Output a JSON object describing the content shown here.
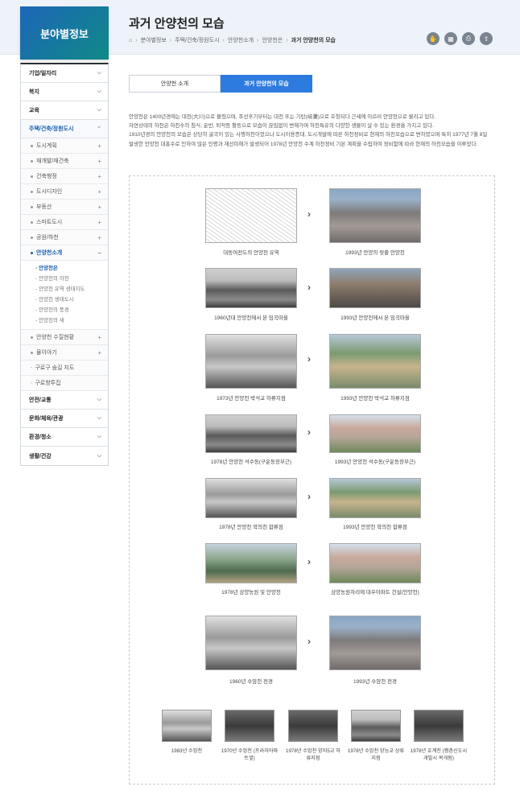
{
  "section_title": "분야별정보",
  "page": {
    "title": "과거 안양천의 모습",
    "breadcrumb": [
      "분야별정보",
      "주택/건축/정원도시",
      "안양천소개",
      "안양천은",
      "과거 안양천의 모습"
    ]
  },
  "tools": [
    {
      "icon": "hand-icon"
    },
    {
      "icon": "qr-icon"
    },
    {
      "icon": "print-icon"
    },
    {
      "icon": "share-icon"
    }
  ],
  "sidenav": {
    "items": [
      {
        "label": "기업/일자리"
      },
      {
        "label": "복지"
      },
      {
        "label": "교육"
      },
      {
        "label": "주택/건축/정원도시"
      },
      {
        "label": "안전/교통"
      },
      {
        "label": "문화/체육/관광"
      },
      {
        "label": "환경/청소"
      },
      {
        "label": "생활/건강"
      }
    ],
    "sub": [
      {
        "label": "도시계획"
      },
      {
        "label": "재개발/재건축"
      },
      {
        "label": "건축행정"
      },
      {
        "label": "도시디자인"
      },
      {
        "label": "부동산"
      },
      {
        "label": "스마트도시"
      },
      {
        "label": "공원/하천"
      },
      {
        "label": "안양천소개"
      }
    ],
    "subsub": [
      "안양천은",
      "안양천의 하천",
      "안양천 유역 생태지도",
      "안양천 생태도시",
      "안양천의 풍경",
      "안양천의 새"
    ],
    "sub_after": [
      {
        "label": "안양천 수질현황"
      },
      {
        "label": "물이야기"
      }
    ],
    "plain": [
      "구로구 숨길 지도",
      "구로향투집"
    ]
  },
  "tabs": [
    "안양천 소개",
    "과거 안양천의 모습"
  ],
  "intro": [
    "안양천은 1400년경에는 대천(大川)으로 불렸으며, 조선후기부터는 대천 또는 기탄(岐灘)으로 호칭되다 근세에 이르러 안양천으로 불리고 있다.",
    "자연상태의 하천은 하천수의 침식, 운반, 퇴적등 활동으로 모습이 끊임없이 변해가며 하천특유의 다양한 생물이 살 수 있는 환경을 가지고 있다.",
    "1910년경의 안양천의 모습은 상당히 굴곡이 있는 사행하천이었으나 도시이용증대, 도시개발에 따른 하천정비로 현재의 하천모습으로 변하였으며 특히 1977년 7월 8일 발생한 안양천 대홍수로 인하여 많은 인명과 재산피해가 발생되어 1978년 안양천 수계 하천정비 기본 계획을 수립하여 정비함에 따라 현재의 하천모습을 이루었다."
  ],
  "gallery": [
    {
      "before": "대동여전도의 안양천 유역",
      "after": "1993년 안양의 젖줄 안양천"
    },
    {
      "before": "1960년대 안양천에서 본 임곡마을",
      "after": "1993년 안양천에서 본 임곡마을"
    },
    {
      "before": "1973년 안양천 박석교 하류지점",
      "after": "1993년 안양천 박석교 하류지점"
    },
    {
      "before": "1978년 안양천 석수동(구운동장부근)",
      "after": "1993년 안양천 석수동(구운동장부근)"
    },
    {
      "before": "1978년 안양천 학의천 합류점",
      "after": "1993년 안양천 학의천 합류점"
    },
    {
      "before": "1978년 삼양농원 및 안양천",
      "after": "삼양농원자리에 대우아파트 건설(안양천)"
    },
    {
      "before": "1960년 수암천 전경",
      "after": "1993년 수암천 전경"
    }
  ],
  "thumbs": [
    {
      "caption": "1983년 수암천"
    },
    {
      "caption": "1970년 수암천 (프라자아파트옆)"
    },
    {
      "caption": "1978년 수암천 양지5교 하류지점"
    },
    {
      "caption": "1978년 수암천 양능교 상류지점"
    },
    {
      "caption": "1978년 호계천 (평촌신도시개발시 복개됨)"
    }
  ]
}
